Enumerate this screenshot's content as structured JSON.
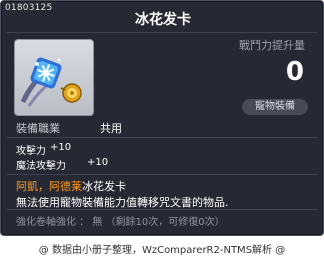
{
  "item": {
    "id": "01803125",
    "name": "冰花发卡",
    "icon": "snowflake-hairpin-icon"
  },
  "power": {
    "label": "戰鬥力提升量",
    "value": "0"
  },
  "badge": "寵物裝備",
  "job": {
    "label": "裝備職業",
    "value": "共用"
  },
  "stats": [
    {
      "label": "攻擊力",
      "value": "+10"
    },
    {
      "label": "魔法攻擊力",
      "value": "+10"
    }
  ],
  "description": {
    "pet_names": "阿凱，阿德莱",
    "item_name": "冰花发卡",
    "line2": "無法使用寵物裝備能力值轉移咒文書的物品."
  },
  "enhancement": "強化卷軸強化 ： 無 （剩餘10次，可修復0次）",
  "footer": "@ 数据由小册子整理，WzComparerR2-NTMS解析 @",
  "colors": {
    "background": "#262933",
    "orange_text": "#ff9a1f",
    "gray_text": "#9aa0ad"
  }
}
